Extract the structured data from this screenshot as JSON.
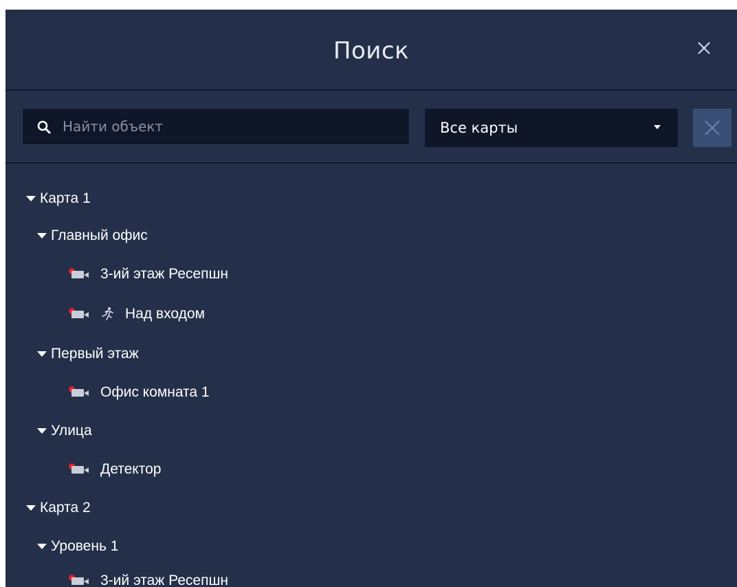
{
  "dialog": {
    "title": "Поиск",
    "close_icon": "close-icon"
  },
  "toolbar": {
    "search": {
      "placeholder": "Найти объект",
      "value": "",
      "icon": "search-icon"
    },
    "map_select": {
      "selected": "Все карты",
      "icon": "chevron-down-icon"
    },
    "clear_button_icon": "close-icon"
  },
  "tree": [
    {
      "label": "Карта 1",
      "type": "map",
      "expanded": true
    },
    {
      "label": "Главный офис",
      "type": "group",
      "expanded": true
    },
    {
      "label": "3-ий этаж Ресепшн",
      "type": "camera",
      "alarm": true
    },
    {
      "label": "Над входом",
      "type": "camera",
      "alarm": true,
      "motion": true
    },
    {
      "label": "Первый этаж",
      "type": "group",
      "expanded": true
    },
    {
      "label": "Офис комната 1",
      "type": "camera",
      "alarm": true
    },
    {
      "label": "Улица",
      "type": "group",
      "expanded": true
    },
    {
      "label": "Детектор",
      "type": "camera",
      "alarm": true
    },
    {
      "label": "Карта 2",
      "type": "map",
      "expanded": true
    },
    {
      "label": "Уровень 1",
      "type": "group",
      "expanded": true
    },
    {
      "label": "3-ий этаж Ресепшн",
      "type": "camera",
      "alarm": true
    }
  ],
  "colors": {
    "background": "#243049",
    "input_background": "#0f1628",
    "alarm_dot": "#e4202c",
    "clear_button": "#3a4d74"
  }
}
